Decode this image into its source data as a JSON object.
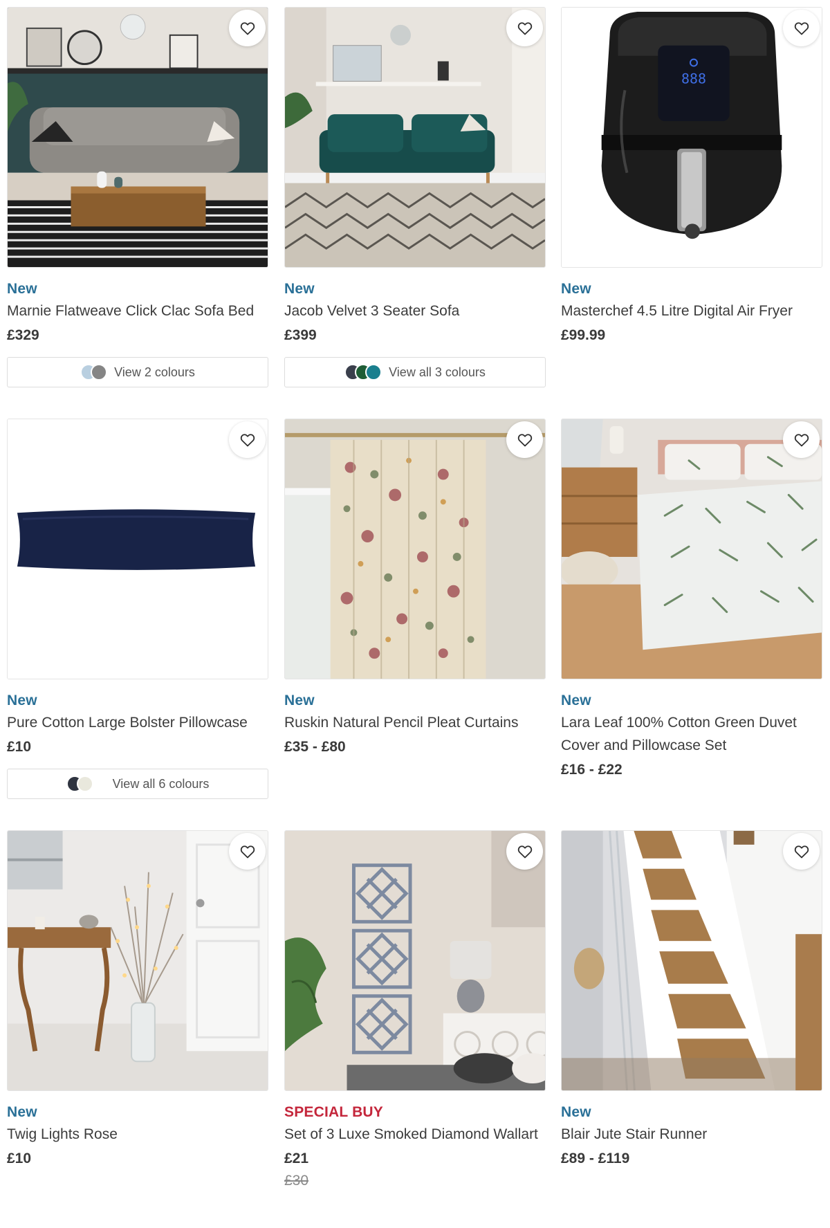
{
  "wishlist_icon": "heart-outline-icon",
  "products": [
    {
      "badge": "New",
      "badge_type": "new",
      "title": "Marnie Flatweave Click Clac Sofa Bed",
      "price": "£329",
      "colours_label": "View 2 colours",
      "swatches": [
        "#b9cfe0",
        "#858585"
      ]
    },
    {
      "badge": "New",
      "badge_type": "new",
      "title": "Jacob Velvet 3 Seater Sofa",
      "price": "£399",
      "colours_label": "View all 3 colours",
      "swatches": [
        "#3a3f4c",
        "#1e5d35",
        "#1a7f8e"
      ]
    },
    {
      "badge": "New",
      "badge_type": "new",
      "title": "Masterchef 4.5 Litre Digital Air Fryer",
      "price": "£99.99"
    },
    {
      "badge": "New",
      "badge_type": "new",
      "title": "Pure Cotton Large Bolster Pillowcase",
      "price": "£10",
      "colours_label": "View all 6 colours",
      "swatches": [
        "#2f3440",
        "#e9e8dd"
      ]
    },
    {
      "badge": "New",
      "badge_type": "new",
      "title": "Ruskin Natural Pencil Pleat Curtains",
      "price": "£35 - £80"
    },
    {
      "badge": "New",
      "badge_type": "new",
      "title": "Lara Leaf 100% Cotton Green Duvet Cover and Pillowcase Set",
      "price": "£16 - £22"
    },
    {
      "badge": "New",
      "badge_type": "new",
      "title": "Twig Lights Rose",
      "price": "£10"
    },
    {
      "badge": "SPECIAL BUY",
      "badge_type": "special",
      "title": "Set of 3 Luxe Smoked Diamond Wallart",
      "price": "£21",
      "was_price": "£30"
    },
    {
      "badge": "New",
      "badge_type": "new",
      "title": "Blair Jute Stair Runner",
      "price": "£89 - £119"
    }
  ]
}
